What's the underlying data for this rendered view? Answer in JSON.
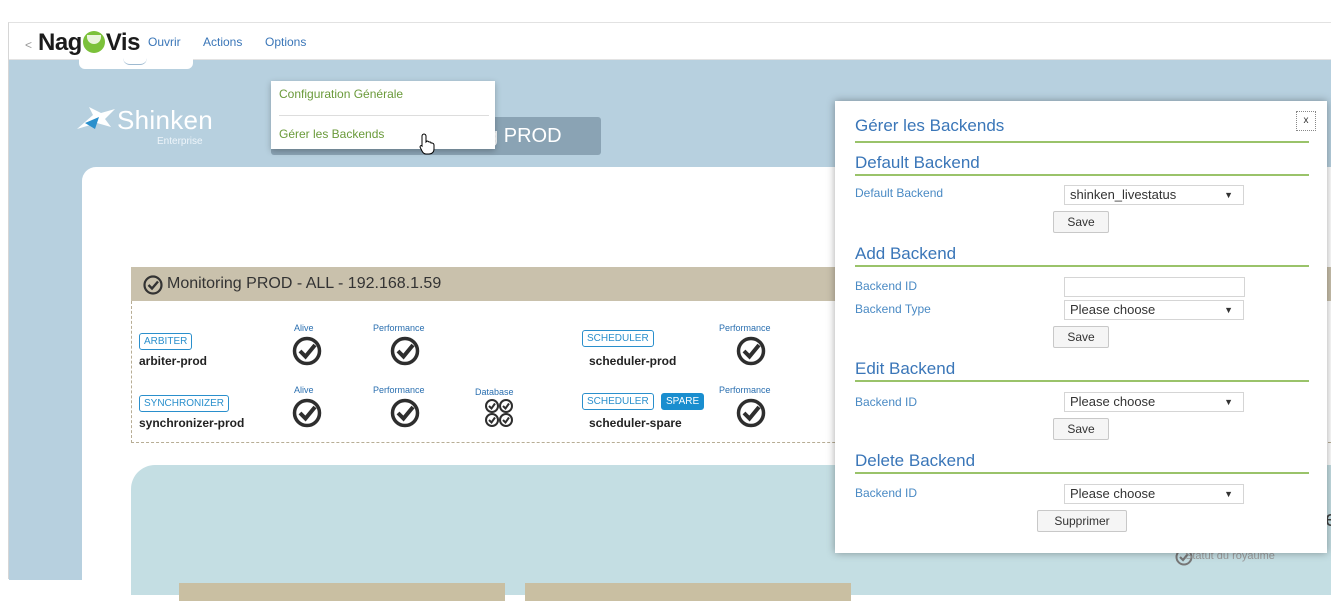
{
  "topbar": {
    "collapse_glyph": "<",
    "logo_left": "Nag",
    "logo_right": "Vis",
    "menu": [
      "Ouvrir",
      "Actions",
      "Options"
    ]
  },
  "options_menu": {
    "items": [
      "Configuration Générale",
      "Gérer les Backends"
    ]
  },
  "map": {
    "brand_name": "Shinken",
    "brand_sub": "Enterprise",
    "title": "Architecture: Monitoring PROD",
    "realm_title": "Monitoring PROD - ALL - 192.168.1.59",
    "daemons": [
      {
        "role": "ARBITER",
        "name": "arbiter-prod"
      },
      {
        "role": "SYNCHRONIZER",
        "name": "synchronizer-prod"
      },
      {
        "role": "SCHEDULER",
        "name": "scheduler-prod"
      },
      {
        "role": "SCHEDULER",
        "badge": "SPARE",
        "name": "scheduler-spare"
      }
    ],
    "check_labels": {
      "alive": "Alive",
      "performance": "Performance",
      "database": "Database"
    },
    "realm_status": "Statut du royaume",
    "partial_text": "e"
  },
  "dialog": {
    "title": "Gérer les Backends",
    "close": "x",
    "default_section": "Default Backend",
    "default_label": "Default Backend",
    "default_value": "shinken_livestatus",
    "add_section": "Add Backend",
    "add_id_label": "Backend ID",
    "add_id_value": "",
    "add_type_label": "Backend Type",
    "add_type_value": "Please choose",
    "edit_section": "Edit Backend",
    "edit_id_label": "Backend ID",
    "edit_id_value": "Please choose",
    "delete_section": "Delete Backend",
    "delete_id_label": "Backend ID",
    "delete_id_value": "Please choose",
    "save": "Save",
    "delete": "Supprimer"
  },
  "colors": {
    "accent_blue": "#3a76b8",
    "accent_green": "#9ac36a",
    "check_ok": "#2e2e2e",
    "map_background": "#b7d0df"
  }
}
